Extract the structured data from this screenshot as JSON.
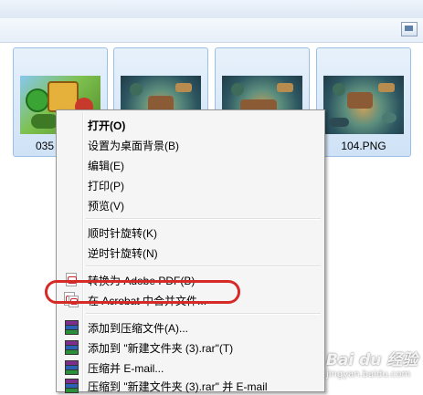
{
  "files": [
    {
      "caption": "035",
      "thumb": "pvz-game-art"
    },
    {
      "caption": "",
      "thumb": "game-map-1"
    },
    {
      "caption": "",
      "thumb": "game-map-2"
    },
    {
      "caption": "104.PNG",
      "thumb": "game-map-3"
    }
  ],
  "menu": {
    "items": [
      {
        "label": "打开(O)",
        "bold": true
      },
      {
        "label": "设置为桌面背景(B)"
      },
      {
        "label": "编辑(E)"
      },
      {
        "label": "打印(P)"
      },
      {
        "label": "预览(V)"
      },
      {
        "label": "顺时针旋转(K)"
      },
      {
        "label": "逆时针旋转(N)"
      },
      {
        "label": "转换为 Adobe PDF(B)",
        "icon": "adobe-pdf-icon"
      },
      {
        "label": "在 Acrobat 中合并文件...",
        "icon": "acrobat-combine-icon"
      },
      {
        "label": "添加到压缩文件(A)...",
        "icon": "winrar-icon"
      },
      {
        "label": "添加到 \"新建文件夹 (3).rar\"(T)",
        "icon": "winrar-icon"
      },
      {
        "label": "压缩并 E-mail...",
        "icon": "winrar-icon"
      },
      {
        "label": "压缩到 \"新建文件夹 (3).rar\" 并 E-mail",
        "icon": "winrar-icon"
      }
    ]
  },
  "annotation": {
    "color": "#d62a27",
    "target": "在 Acrobat 中合并文件..."
  },
  "watermark": {
    "brand": "Bai du 经验",
    "sub": "jingyan.baidu.com"
  }
}
